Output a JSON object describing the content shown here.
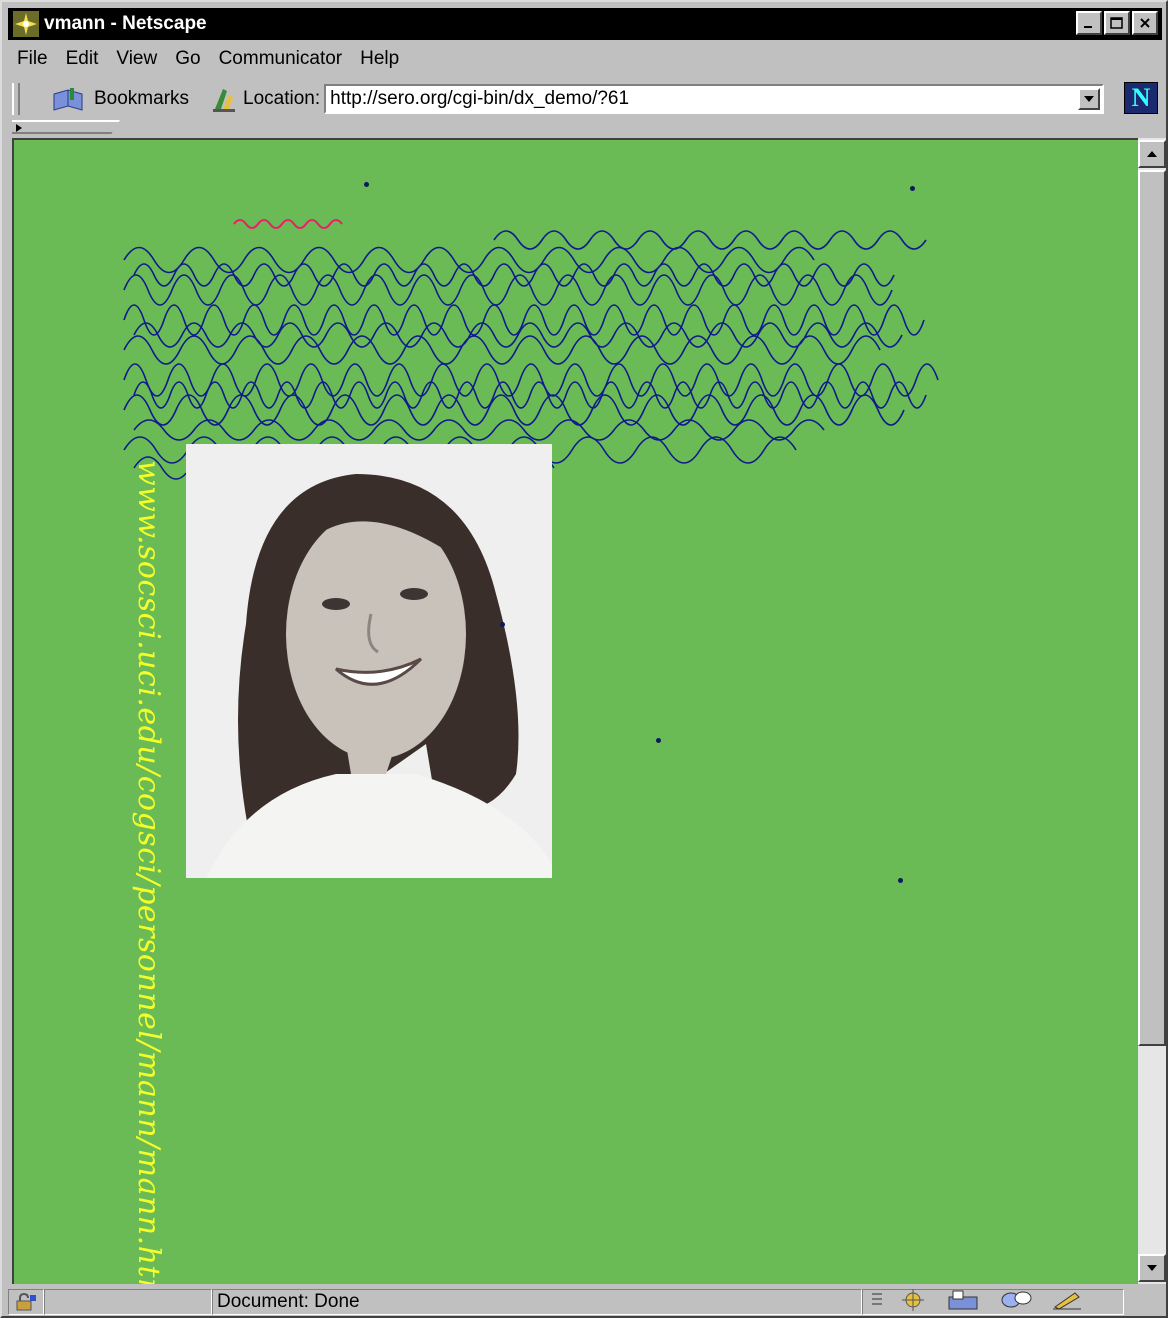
{
  "window": {
    "title": "vmann - Netscape",
    "minimize": "_",
    "maximize": "□",
    "close": "✕"
  },
  "menu": {
    "items": [
      {
        "label": "File"
      },
      {
        "label": "Edit"
      },
      {
        "label": "View"
      },
      {
        "label": "Go"
      },
      {
        "label": "Communicator"
      },
      {
        "label": "Help"
      }
    ]
  },
  "toolbar": {
    "bookmarks_label": "Bookmarks",
    "location_label": "Location:",
    "url": "http://sero.org/cgi-bin/dx_demo/?61",
    "brand_letter": "N"
  },
  "page": {
    "vertical_url": "www.socsci.uci.edu/cogsci/personnel/mann/mann.html",
    "background": "#6aba56",
    "url_color": "#f4ff2a",
    "scribble_color": "#101a8c"
  },
  "status": {
    "text": "Document: Done"
  },
  "icons": [
    "netscape-logo-icon",
    "bookmarks-icon",
    "location-icon",
    "security-lock-icon",
    "component-bar-icons"
  ]
}
